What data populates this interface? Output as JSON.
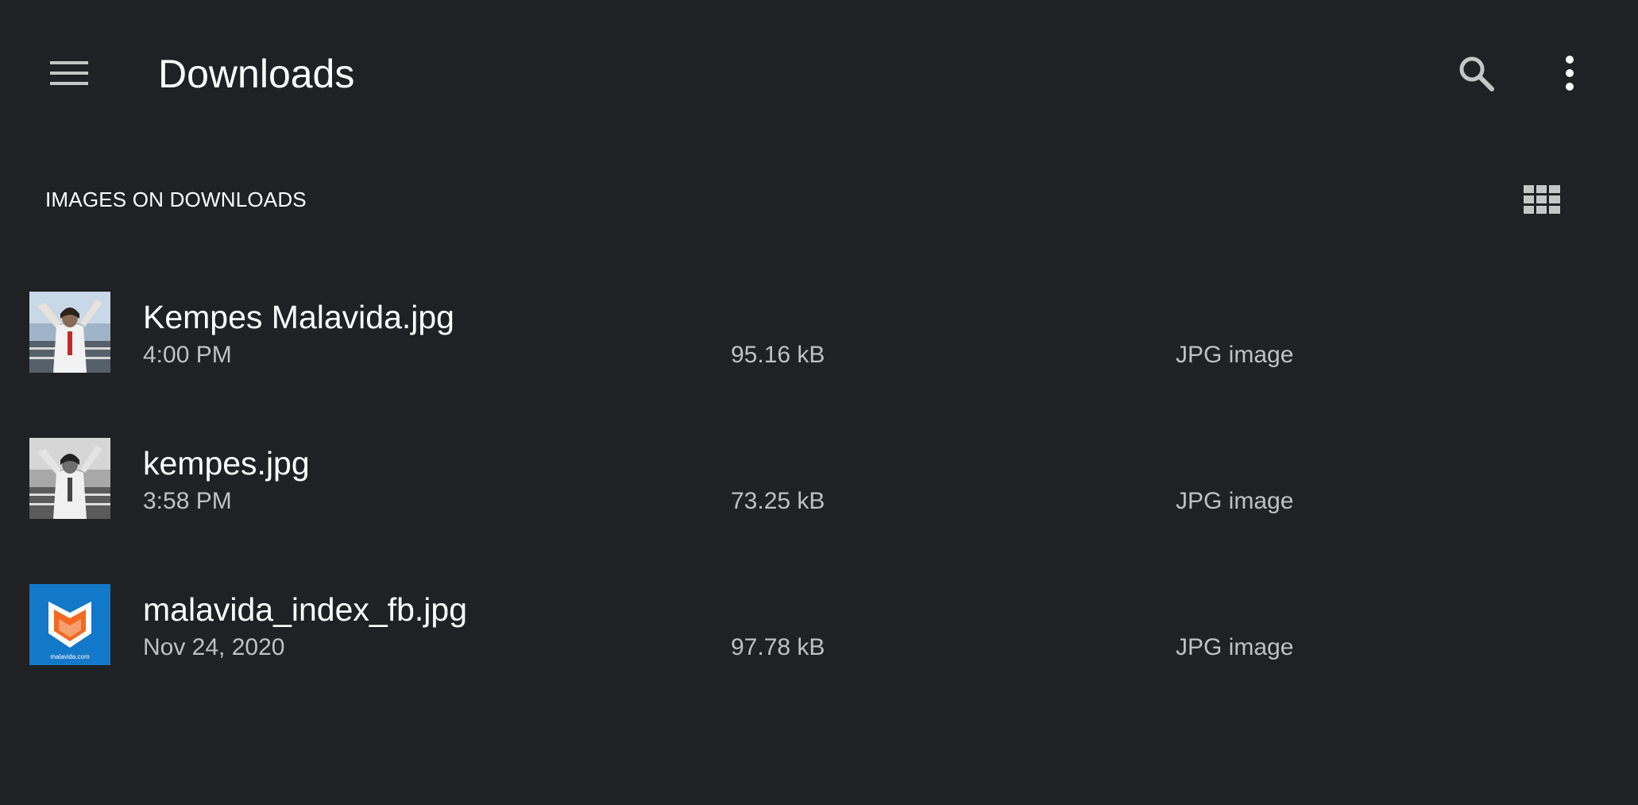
{
  "colors": {
    "background": "#202124",
    "primary_text": "#ffffff",
    "secondary_text": "#bdc1c6",
    "icon": "#c4c7c5",
    "malavida_blue": "#1478c8",
    "malavida_orange": "#f26a21"
  },
  "toolbar": {
    "menu_icon": "hamburger-menu-icon",
    "title": "Downloads",
    "search_icon": "search-icon",
    "more_icon": "more-vert-icon"
  },
  "section": {
    "title": "IMAGES ON DOWNLOADS",
    "view_toggle_icon": "grid-view-icon"
  },
  "files": [
    {
      "name": "Kempes Malavida.jpg",
      "date": "4:00 PM",
      "size": "95.16 kB",
      "type": "JPG image",
      "thumbnail": "photo-thumbnail"
    },
    {
      "name": "kempes.jpg",
      "date": "3:58 PM",
      "size": "73.25 kB",
      "type": "JPG image",
      "thumbnail": "photo-thumbnail"
    },
    {
      "name": "malavida_index_fb.jpg",
      "date": "Nov 24, 2020",
      "size": "97.78 kB",
      "type": "JPG image",
      "thumbnail": "malavida-logo-thumbnail",
      "thumbnail_caption": "malavida.com"
    }
  ]
}
